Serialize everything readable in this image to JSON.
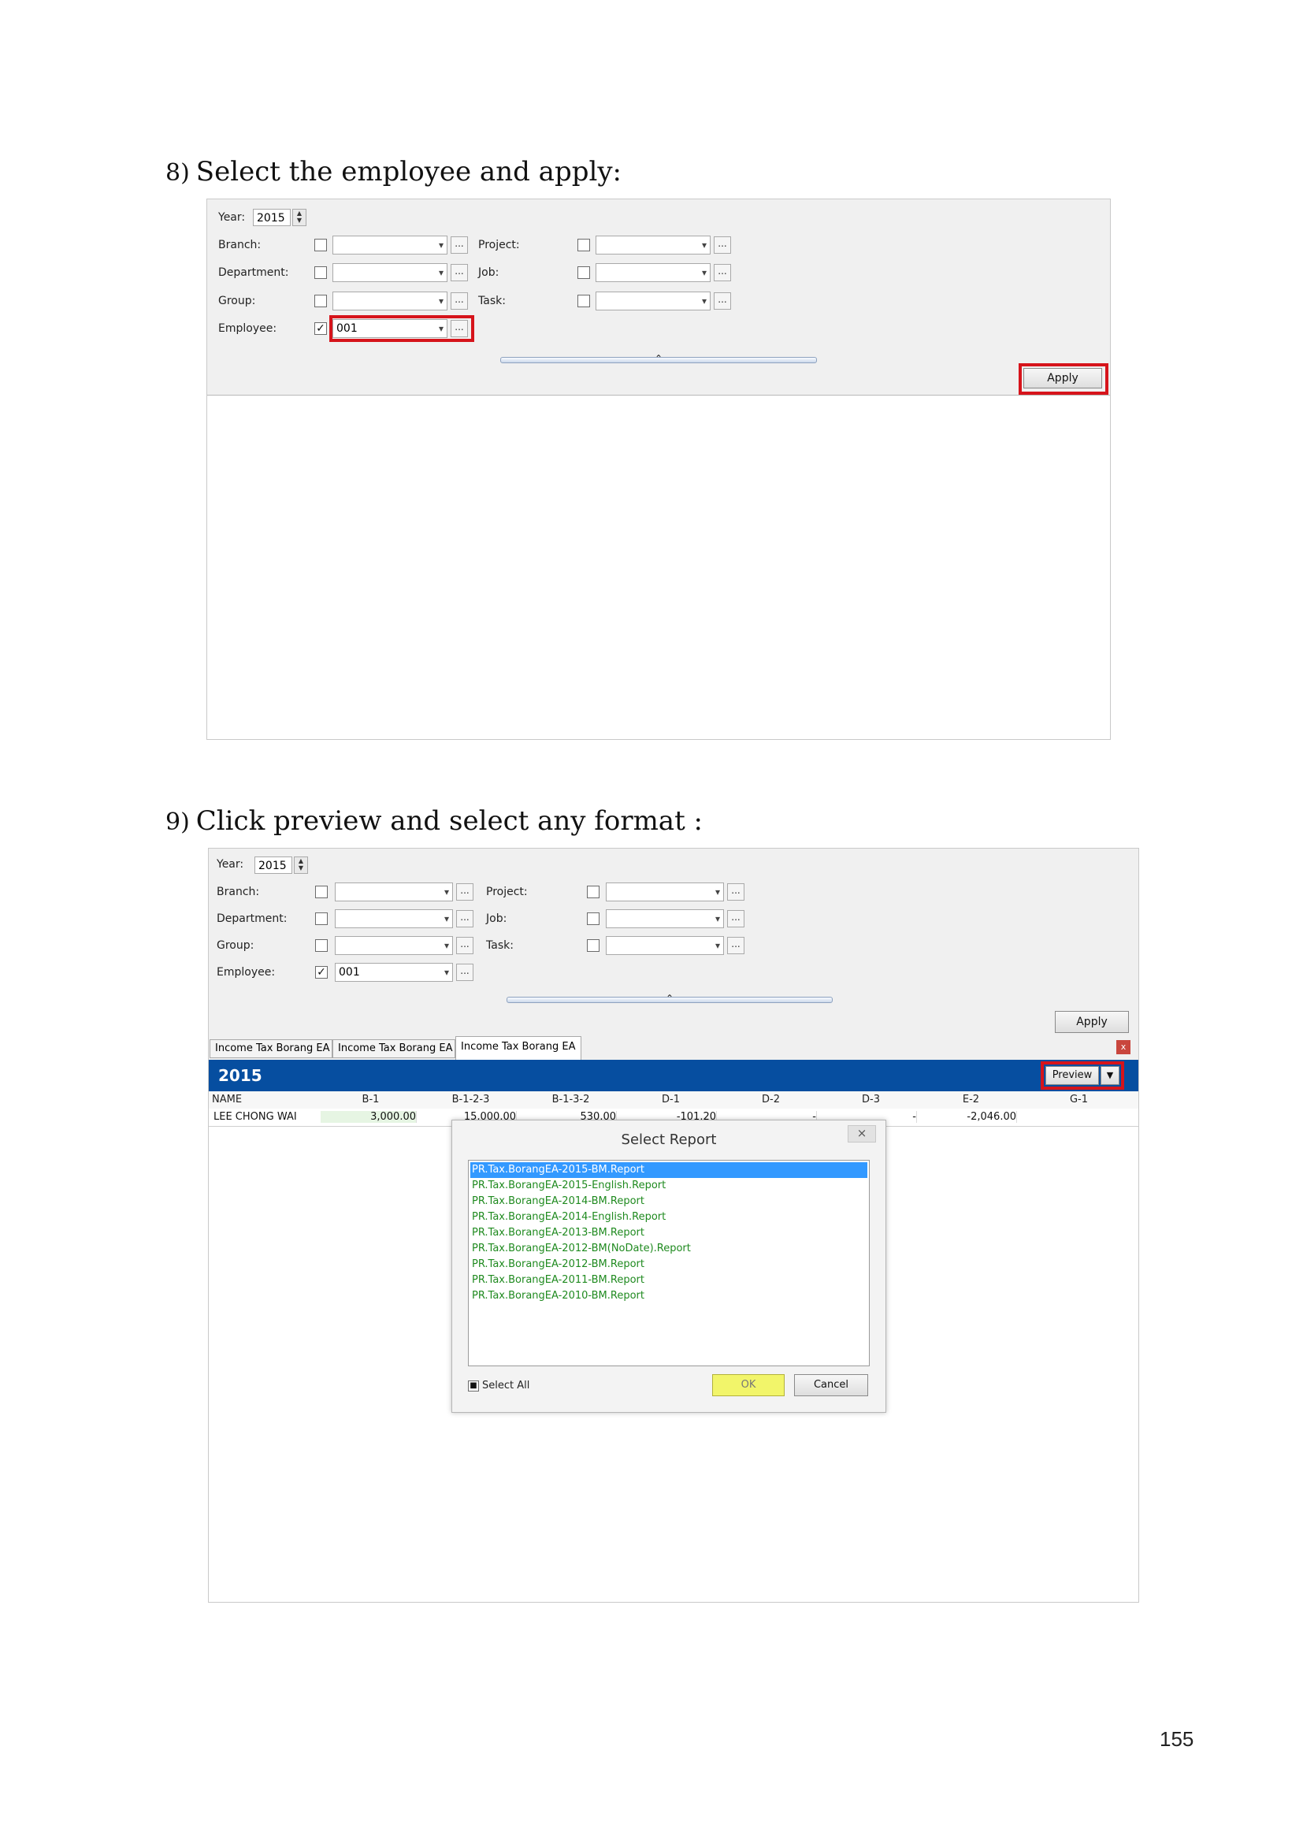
{
  "step8": {
    "number": "8)",
    "text": "Select the employee and apply:",
    "year_label": "Year:",
    "year_value": "2015",
    "labels": {
      "branch": "Branch:",
      "department": "Department:",
      "group": "Group:",
      "employee": "Employee:",
      "project": "Project:",
      "job": "Job:",
      "task": "Task:"
    },
    "employee_value": "001",
    "employee_checked": true,
    "ellipsis": "...",
    "apply_label": "Apply",
    "highlight_color": "#d6141b"
  },
  "step9": {
    "number": "9)",
    "text": "Click preview and select any format :",
    "year_label": "Year:",
    "year_value": "2015",
    "labels": {
      "branch": "Branch:",
      "department": "Department:",
      "group": "Group:",
      "employee": "Employee:",
      "project": "Project:",
      "job": "Job:",
      "task": "Task:"
    },
    "employee_value": "001",
    "ellipsis": "...",
    "apply_label": "Apply",
    "tabs": [
      "Income Tax Borang EA",
      "Income Tax Borang EA",
      "Income Tax Borang EA"
    ],
    "active_tab": 2,
    "close_glyph": "x",
    "bar_year": "2015",
    "bar_color": "#064ea0",
    "preview_label": "Preview",
    "grid": {
      "columns": [
        "NAME",
        "B-1",
        "B-1-2-3",
        "B-1-3-2",
        "D-1",
        "D-2",
        "D-3",
        "E-2",
        "G-1"
      ],
      "row": [
        "LEE CHONG WAI",
        "3,000.00",
        "15,000.00",
        "530.00",
        "-101.20",
        "-",
        "-",
        "-2,046.00",
        ""
      ]
    },
    "dialog": {
      "title": "Select Report",
      "close": "×",
      "reports": [
        "PR.Tax.BorangEA-2015-BM.Report",
        "PR.Tax.BorangEA-2015-English.Report",
        "PR.Tax.BorangEA-2014-BM.Report",
        "PR.Tax.BorangEA-2014-English.Report",
        "PR.Tax.BorangEA-2013-BM.Report",
        "PR.Tax.BorangEA-2012-BM(NoDate).Report",
        "PR.Tax.BorangEA-2012-BM.Report",
        "PR.Tax.BorangEA-2011-BM.Report",
        "PR.Tax.BorangEA-2010-BM.Report"
      ],
      "selected_index": 0,
      "select_all": "Select All",
      "ok": "OK",
      "cancel": "Cancel",
      "report_color": "#1f8a1f",
      "ok_color": "#f2f56a"
    }
  },
  "page_number": "155"
}
